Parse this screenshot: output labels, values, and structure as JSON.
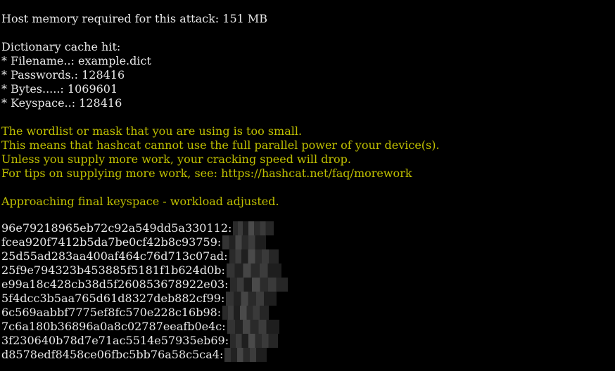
{
  "terminal": {
    "lines": {
      "host_memory": "Host memory required for this attack: 151 MB",
      "dict_cache": "Dictionary cache hit:",
      "filename": "* Filename..: example.dict",
      "passwords": "* Passwords.: 128416",
      "bytes": "* Bytes.....: 1069601",
      "keyspace": "* Keyspace..: 128416"
    },
    "warnings": {
      "w1": "The wordlist or mask that you are using is too small.",
      "w2": "This means that hashcat cannot use the full parallel power of your device(s).",
      "w3": "Unless you supply more work, your cracking speed will drop.",
      "w4": "For tips on supplying more work, see: https://hashcat.net/faq/morework",
      "w5": "Approaching final keyspace - workload adjusted."
    },
    "hashes": [
      "96e79218965eb72c92a549dd5a330112:",
      "fcea920f7412b5da7be0cf42b8c93759:",
      "25d55ad283aa400af464c76d713c07ad:",
      "25f9e794323b453885f5181f1b624d0b:",
      "e99a18c428cb38d5f260853678922e03:",
      "5f4dcc3b5aa765d61d8327deb882cf99:",
      "6c569aabbf7775ef8fc570e228c16b98:",
      "7c6a180b36896a0a8c02787eeafb0e4c:",
      "3f230640b78d7e71ac5514e57935eb69:",
      "d8578edf8458ce06fbc5bb76a58c5ca4:"
    ],
    "colors": {
      "background": "#000000",
      "text": "#e8e8e8",
      "warning": "#c0c000"
    }
  }
}
